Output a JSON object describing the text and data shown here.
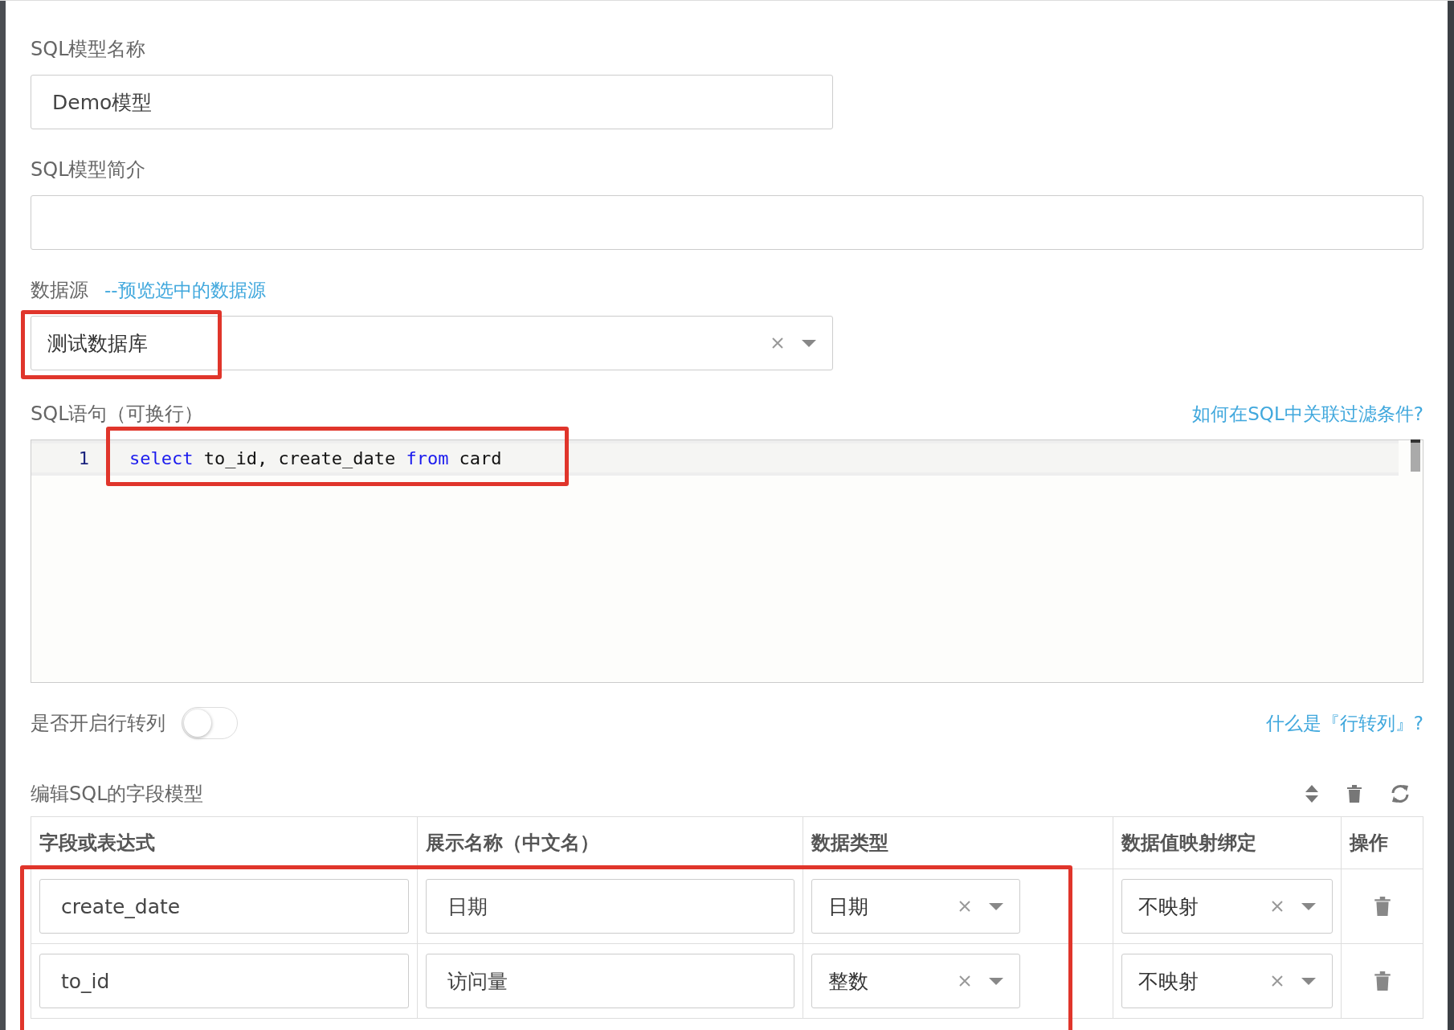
{
  "name_field": {
    "label": "SQL模型名称",
    "value": "Demo模型"
  },
  "desc_field": {
    "label": "SQL模型简介"
  },
  "datasource": {
    "label": "数据源",
    "link": "--预览选中的数据源",
    "value": "测试数据库",
    "highlighted": true
  },
  "sql": {
    "label": "SQL语句（可换行）",
    "link": "如何在SQL中关联过滤条件?",
    "highlighted": true,
    "lines": [
      {
        "number": "1",
        "tokens": [
          {
            "text": "select",
            "kind": "keyword"
          },
          {
            "text": " to_id, create_date ",
            "kind": "plain"
          },
          {
            "text": "from",
            "kind": "keyword"
          },
          {
            "text": " card",
            "kind": "plain"
          }
        ]
      }
    ]
  },
  "pivot": {
    "label": "是否开启行转列",
    "on": false,
    "link": "什么是『行转列』?"
  },
  "fields": {
    "title": "编辑SQL的字段模型",
    "columns": [
      "字段或表达式",
      "展示名称（中文名）",
      "数据类型",
      "数据值映射绑定",
      "操作"
    ],
    "highlighted": true,
    "rows": [
      {
        "field": "create_date",
        "display": "日期",
        "type": "日期",
        "mapping": "不映射"
      },
      {
        "field": "to_id",
        "display": "访问量",
        "type": "整数",
        "mapping": "不映射"
      }
    ]
  }
}
